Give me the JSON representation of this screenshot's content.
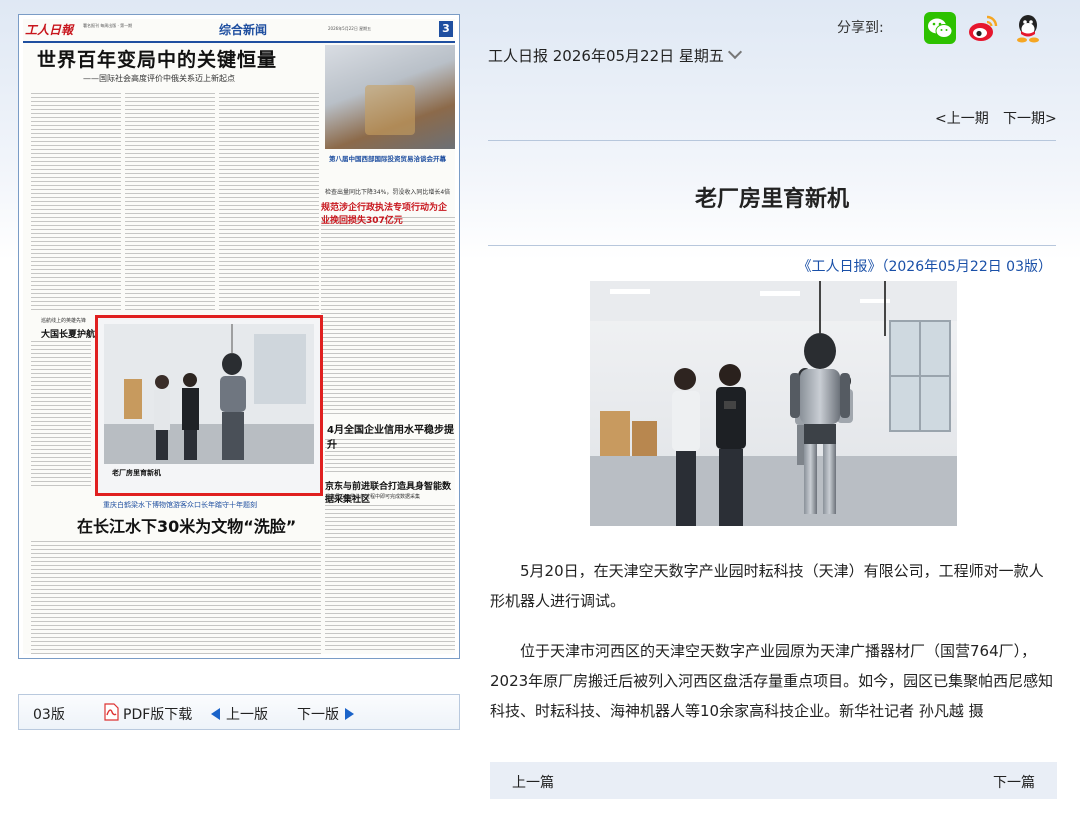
{
  "paper": {
    "masthead": "工人日報",
    "masthead_small": "署名报刊 每周出版 · 第一期",
    "section": "综合新闻",
    "date": "2026年5月22日 星期五",
    "page_no": "3",
    "headline": "世界百年变局中的关键恒量",
    "subheadline": "——国际社会高度评价中俄关系迈上新起点",
    "photo_caption": "第八届中国西部国际投资贸易洽谈会开幕",
    "headline2_kicker": "检查出量同比下降34%，罚没收入同比增长4倍",
    "headline2": "规范涉企行政执法专项行动为企业挽回损失307亿元",
    "headline3_kicker": "巡航线上的英雄先锋",
    "headline3": "大国长夏护航巡川网施",
    "headline4": "4月全国企业信用水平稳步提升",
    "headline5": "京东与前进联合打造具身智能数据采集社区",
    "headline5_kicker": "采集员在日常业务过程中即可完成数据采集",
    "headline6_kicker": "重庆白鹤梁水下博物馆游客众口长年踏守十年题刻",
    "headline6": "在长江水下30米为文物“洗脸”",
    "selected_caption": "老厂房里育新机"
  },
  "paper_nav": {
    "page": "03版",
    "pdf": "PDF版下载",
    "prev": "上一版",
    "next": "下一版"
  },
  "share": {
    "label": "分享到:",
    "buttons": [
      "wechat-icon",
      "weibo-icon",
      "qq-icon"
    ]
  },
  "issue": {
    "label": "工人日报 2026年05月22日 星期五"
  },
  "issue_nav": {
    "prev": "<上一期",
    "next": "下一期>"
  },
  "article": {
    "title": "老厂房里育新机",
    "source": "《工人日报》（2026年05月22日 03版）",
    "paragraphs": [
      "5月20日，在天津空天数字产业园时耘科技（天津）有限公司，工程师对一款人形机器人进行调试。",
      "位于天津市河西区的天津空天数字产业园原为天津广播器材厂（国营764厂），2023年原厂房搬迁后被列入河西区盘活存量重点项目。如今，园区已集聚帕西尼感知科技、时耘科技、海神机器人等10余家高科技企业。新华社记者 孙凡越 摄"
    ]
  },
  "article_nav": {
    "prev": "上一篇",
    "next": "下一篇"
  },
  "colors": {
    "accent_blue": "#1a50a8",
    "highlight_red": "#e02020",
    "nav_bg": "#e9eef6"
  }
}
